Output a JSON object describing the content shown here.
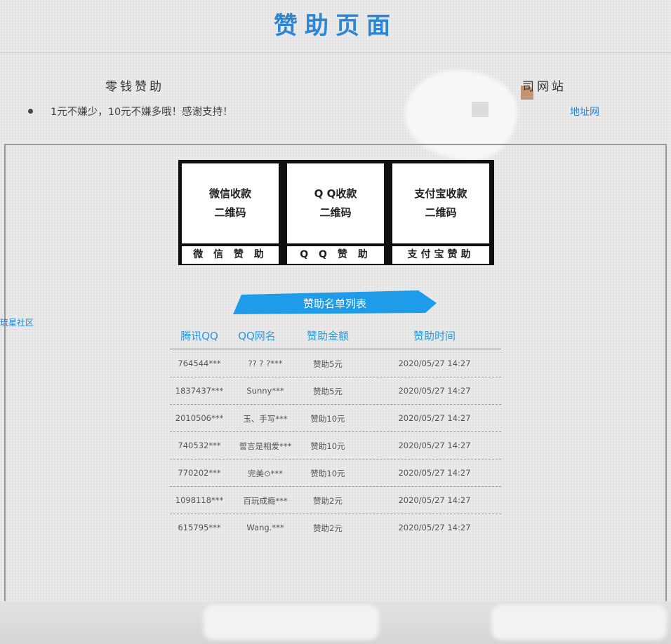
{
  "header": {
    "title": "赞助页面"
  },
  "left_section": {
    "heading": "零钱赞助",
    "note": "1元不嫌少，10元不嫌多哦！感谢支持！"
  },
  "right_section": {
    "heading_partial": "司网站",
    "link": "地址网"
  },
  "side_link": "琉星社区",
  "qr_codes": [
    {
      "line1": "微信收款",
      "line2": "二维码",
      "label": "微 信 赞 助"
    },
    {
      "line1": "Q Q收款",
      "line2": "二维码",
      "label": "Q Q 赞 助"
    },
    {
      "line1": "支付宝收款",
      "line2": "二维码",
      "label": "支付宝赞助"
    }
  ],
  "sponsor_list": {
    "ribbon_title": "赞助名单列表",
    "ribbon_color": "#1e9be9",
    "columns": [
      "腾讯QQ",
      "QQ网名",
      "赞助金额",
      "赞助时间"
    ],
    "rows": [
      [
        "764544***",
        "?? ? ?***",
        "赞助5元",
        "2020/05/27 14:27"
      ],
      [
        "1837437***",
        "Sunny***",
        "赞助5元",
        "2020/05/27 14:27"
      ],
      [
        "2010506***",
        "玉、手写***",
        "赞助10元",
        "2020/05/27 14:27"
      ],
      [
        "740532***",
        "誓言是相爱***",
        "赞助10元",
        "2020/05/27 14:27"
      ],
      [
        "770202***",
        "完美⊙***",
        "赞助10元",
        "2020/05/27 14:27"
      ],
      [
        "1098118***",
        "百玩成瘾***",
        "赞助2元",
        "2020/05/27 14:27"
      ],
      [
        "615795***",
        "Wang.***",
        "赞助2元",
        "2020/05/27 14:27"
      ]
    ]
  }
}
